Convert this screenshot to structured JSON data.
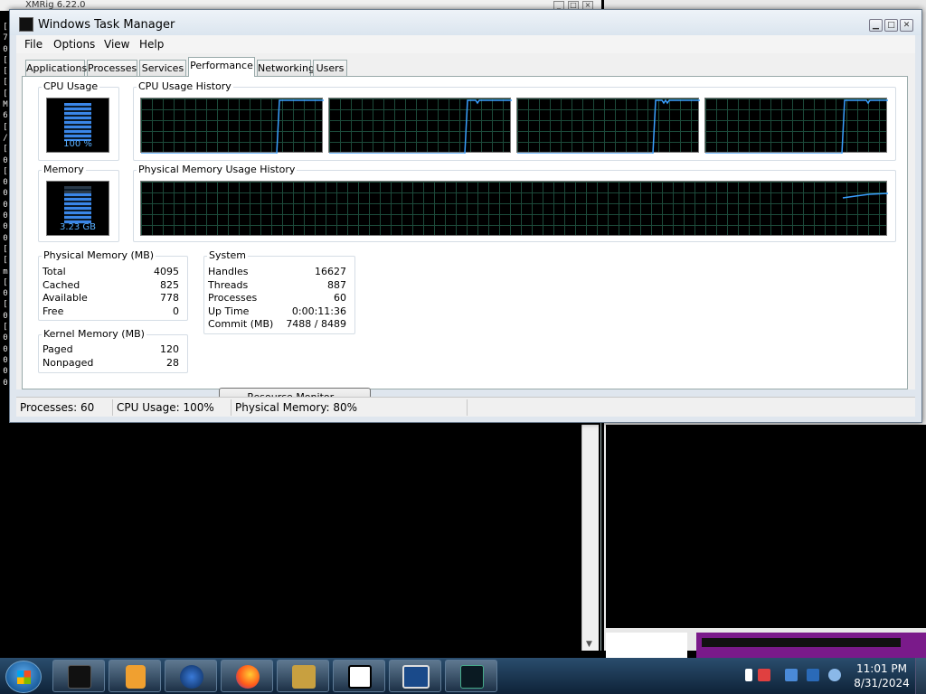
{
  "background_window": {
    "title": "XMRig 6.22.0",
    "left_column_chars": [
      "[",
      "7",
      "0",
      "[",
      "[",
      "[",
      "[",
      "M",
      "6",
      "[",
      "/",
      "[",
      "0",
      "[",
      "0",
      "0",
      "0",
      "0",
      "0",
      "0",
      "[",
      "[",
      "m",
      "[",
      "0",
      "[",
      "0",
      "[",
      "0",
      "0",
      "0",
      "0",
      "0"
    ]
  },
  "task_manager": {
    "title": "Windows Task Manager",
    "menu": [
      "File",
      "Options",
      "View",
      "Help"
    ],
    "tabs": [
      "Applications",
      "Processes",
      "Services",
      "Performance",
      "Networking",
      "Users"
    ],
    "active_tab": "Performance",
    "cpu_usage": {
      "label": "CPU Usage",
      "value": "100 %"
    },
    "cpu_history": {
      "label": "CPU Usage History",
      "cores": 4
    },
    "memory": {
      "label": "Memory",
      "value": "3.23 GB"
    },
    "memory_history": {
      "label": "Physical Memory Usage History"
    },
    "physical_memory": {
      "label": "Physical Memory (MB)",
      "rows": [
        {
          "key": "Total",
          "value": "4095"
        },
        {
          "key": "Cached",
          "value": "825"
        },
        {
          "key": "Available",
          "value": "778"
        },
        {
          "key": "Free",
          "value": "0"
        }
      ]
    },
    "kernel_memory": {
      "label": "Kernel Memory (MB)",
      "rows": [
        {
          "key": "Paged",
          "value": "120"
        },
        {
          "key": "Nonpaged",
          "value": "28"
        }
      ]
    },
    "system": {
      "label": "System",
      "rows": [
        {
          "key": "Handles",
          "value": "16627"
        },
        {
          "key": "Threads",
          "value": "887"
        },
        {
          "key": "Processes",
          "value": "60"
        },
        {
          "key": "Up Time",
          "value": "0:00:11:36"
        },
        {
          "key": "Commit (MB)",
          "value": "7488 / 8489"
        }
      ]
    },
    "resource_monitor_button": "Resource Monitor...",
    "status_bar": {
      "processes": "Processes: 60",
      "cpu": "CPU Usage: 100%",
      "memory": "Physical Memory: 80%"
    }
  },
  "taskbar": {
    "pinned": [
      "terminal-icon",
      "media-player-icon",
      "globe-icon",
      "firefox-icon",
      "sandbox-icon",
      "7zip-icon",
      "monitor-app-icon",
      "task-manager-icon"
    ],
    "clock_time": "11:01 PM",
    "clock_date": "8/31/2024"
  },
  "colors": {
    "graph_line": "#3aa0ff",
    "graph_grid": "#1c4a3a",
    "accent": "#1c5f9e"
  }
}
